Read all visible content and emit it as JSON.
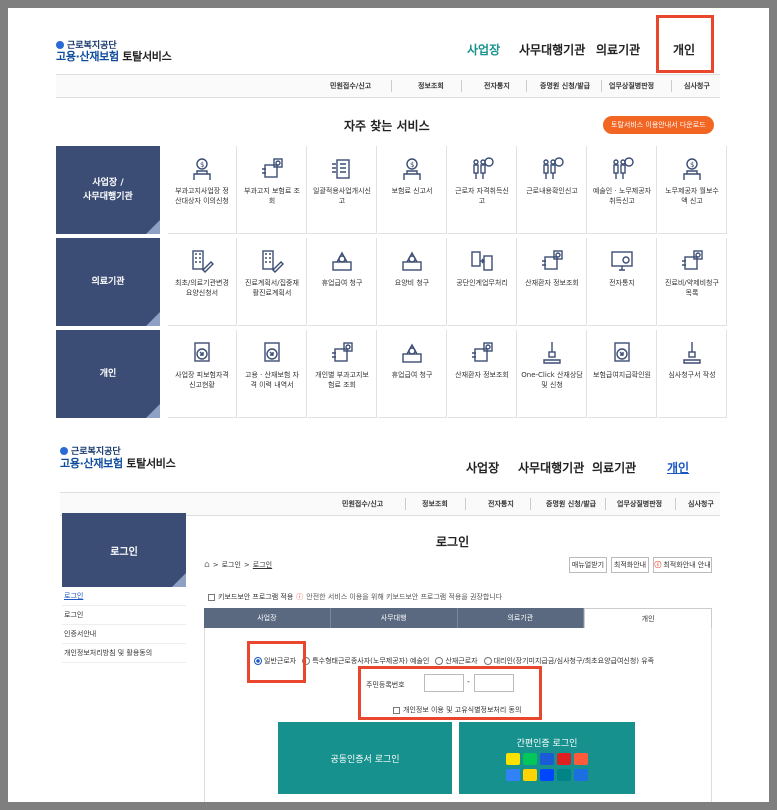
{
  "header1": {
    "org": "근로복지공단",
    "service_main": "고용·산재보험",
    "service_sub": "토탈서비스",
    "nav": [
      "사업장",
      "사무대행기관",
      "의료기관",
      "개인"
    ]
  },
  "menu1": [
    "민원접수/신고",
    "정보조회",
    "전자통지",
    "증명원 신청/발급",
    "업무상질병판정",
    "심사청구"
  ],
  "frequent": {
    "title": "자주 찾는 서비스",
    "download_label": "토탈서비스 이용안내서 다운로드",
    "rows": [
      {
        "label_line1": "사업장 /",
        "label_line2": "사무대행기관",
        "items": [
          {
            "l1": "부과고지사업장 정",
            "l2": "산대상자 이의신청",
            "icon": "money-person-icon"
          },
          {
            "l1": "부과고지 보험료 조",
            "l2": "회",
            "icon": "document-search-icon"
          },
          {
            "l1": "일괄적용사업개시신",
            "l2": "고",
            "icon": "document-list-icon"
          },
          {
            "l1": "보험료 신고서",
            "l2": "",
            "icon": "money-person-icon"
          },
          {
            "l1": "근로자 자격취득신",
            "l2": "고",
            "icon": "people-money-icon"
          },
          {
            "l1": "근로내용확인신고",
            "l2": "",
            "icon": "people-money-icon"
          },
          {
            "l1": "예술인 · 노무제공자",
            "l2": "취득신고",
            "icon": "people-money-icon"
          },
          {
            "l1": "노무제공자 월보수",
            "l2": "액 신고",
            "icon": "money-person-icon"
          }
        ]
      },
      {
        "label_line1": "의료기관",
        "label_line2": "",
        "items": [
          {
            "l1": "최초/의료기관변경",
            "l2": "요양신청서",
            "icon": "building-pen-icon"
          },
          {
            "l1": "진료계획서/집중재",
            "l2": "활진료계획서",
            "icon": "building-pen-icon"
          },
          {
            "l1": "휴업급여 청구",
            "l2": "",
            "icon": "money-box-icon"
          },
          {
            "l1": "요양비 청구",
            "l2": "",
            "icon": "money-box-icon"
          },
          {
            "l1": "공단인계업무처리",
            "l2": "",
            "icon": "transfer-icon"
          },
          {
            "l1": "산재환자 정보조회",
            "l2": "",
            "icon": "document-search-icon"
          },
          {
            "l1": "전자통지",
            "l2": "",
            "icon": "monitor-search-icon"
          },
          {
            "l1": "진료비/약제비청구",
            "l2": "목록",
            "icon": "document-search-icon"
          }
        ]
      },
      {
        "label_line1": "개인",
        "label_line2": "",
        "items": [
          {
            "l1": "사업장 피보험자격",
            "l2": "신고현황",
            "icon": "arrow-card-icon"
          },
          {
            "l1": "고용 · 산재보험 자",
            "l2": "격 이력 내역서",
            "icon": "arrow-card-icon"
          },
          {
            "l1": "개인별 부과고지보",
            "l2": "험료 조회",
            "icon": "document-search-icon"
          },
          {
            "l1": "휴업급여 청구",
            "l2": "",
            "icon": "money-box-icon"
          },
          {
            "l1": "산재환자 정보조회",
            "l2": "",
            "icon": "document-search-icon"
          },
          {
            "l1": "One-Click 산재상담",
            "l2": "및 신청",
            "icon": "stamp-pen-icon"
          },
          {
            "l1": "보험급여지급확인원",
            "l2": "",
            "icon": "arrow-card-icon"
          },
          {
            "l1": "심사청구서 작성",
            "l2": "",
            "icon": "stamp-pen-icon"
          }
        ]
      }
    ]
  },
  "header2": {
    "org": "근로복지공단",
    "service_main": "고용·산재보험",
    "service_sub": "토탈서비스",
    "nav": [
      "사업장",
      "사무대행기관",
      "의료기관",
      "개인"
    ]
  },
  "menu2": [
    "민원접수/신고",
    "정보조회",
    "전자통지",
    "증명원 신청/발급",
    "업무상질병판정",
    "심사청구"
  ],
  "login": {
    "sidebar_title": "로그인",
    "sidebar_items": [
      "로그인",
      "로그인",
      "인증서안내",
      "개인정보처리방침 및 활용동의"
    ],
    "title": "로그인",
    "breadcrumb_1": "로그인",
    "breadcrumb_2": "로그인",
    "btn_help": "매뉴얼받기",
    "btn_browser": "최적화안내",
    "btn_info": "최적화안내 안내",
    "keyboard_note_1": "키보드보안 프로그램 적용",
    "keyboard_note_2": "안전한 서비스 이용을 위해 키보드보안 프로그램 적용을 권장합니다",
    "tabs": [
      "사업장",
      "사무대행",
      "의료기관",
      "개인"
    ],
    "radios": [
      "일반근로자",
      "특수형태근로종사자(노무제공자) 예술인",
      "산재근로자",
      "대리인(장기미지급금/심사청구/최초요양급여신청) 유족"
    ],
    "rrn_label": "주민등록번호",
    "rrn_dash": "-",
    "consent": "개인정보 이용 및 고유식별정보처리 동의",
    "cert_button": "공동인증서 로그인",
    "simple_title": "간편인증 로그인"
  },
  "colors": {
    "accent": "#17918d",
    "navy": "#3b4d74",
    "highlight": "#e8472e",
    "orange": "#f26522"
  }
}
